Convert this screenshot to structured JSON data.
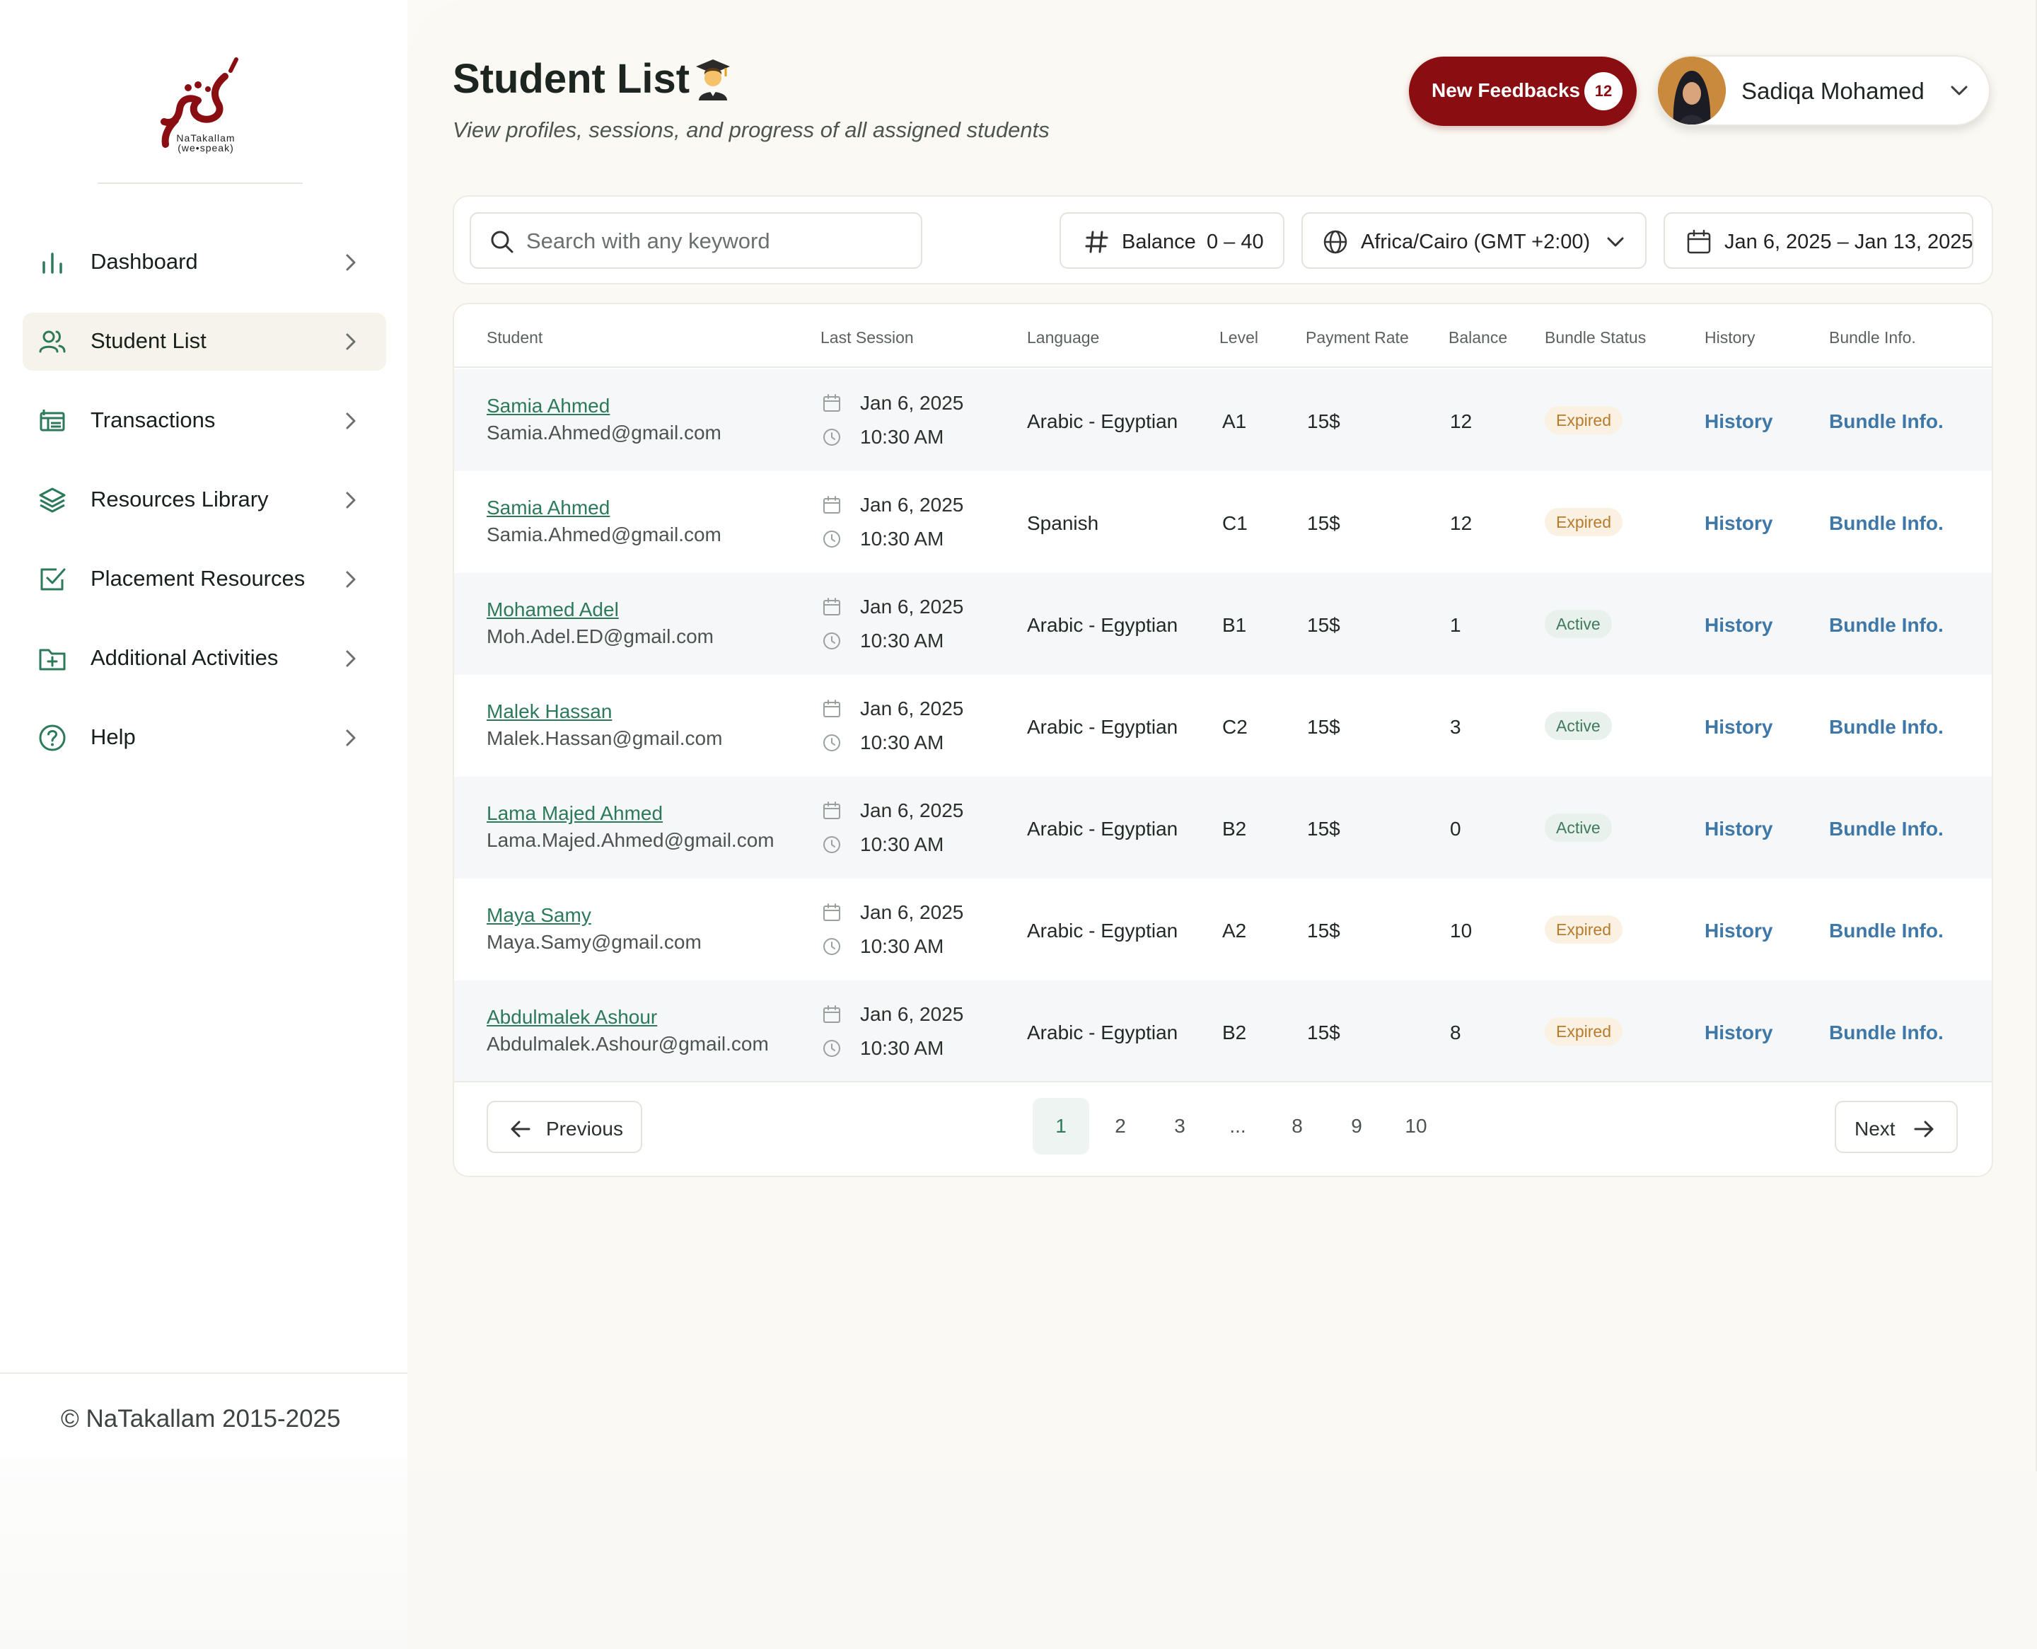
{
  "brand": {
    "logo_caption_line1": "NaTakallam",
    "logo_caption_line2": "(we•speak)",
    "copyright": "© NaTakallam 2015-2025"
  },
  "sidebar": {
    "items": [
      {
        "label": "Dashboard",
        "icon": "bar-chart-icon",
        "active": false
      },
      {
        "label": "Student List",
        "icon": "users-icon",
        "active": true
      },
      {
        "label": "Transactions",
        "icon": "transactions-icon",
        "active": false
      },
      {
        "label": "Resources Library",
        "icon": "layers-icon",
        "active": false
      },
      {
        "label": "Placement Resources",
        "icon": "check-square-icon",
        "active": false
      },
      {
        "label": "Additional Activities",
        "icon": "folder-plus-icon",
        "active": false
      },
      {
        "label": "Help",
        "icon": "help-circle-icon",
        "active": false
      }
    ]
  },
  "header": {
    "title": "Student List",
    "title_emoji": "graduate-emoji",
    "subtitle": "View profiles, sessions, and progress of all assigned students",
    "feedback_label": "New Feedbacks",
    "feedback_count": "12",
    "user_name": "Sadiqa Mohamed"
  },
  "filters": {
    "search_placeholder": "Search with any keyword",
    "balance_label": "Balance",
    "balance_range": "0 – 40",
    "timezone": "Africa/Cairo (GMT +2:00)",
    "date_range": "Jan 6, 2025 – Jan 13, 2025"
  },
  "table": {
    "columns": [
      "Student",
      "Last Session",
      "Language",
      "Level",
      "Payment Rate",
      "Balance",
      "Bundle Status",
      "History",
      "Bundle Info."
    ],
    "rows": [
      {
        "name": "Samia Ahmed",
        "email": "Samia.Ahmed@gmail.com",
        "date": "Jan 6, 2025",
        "time": "10:30 AM",
        "language": "Arabic - Egyptian",
        "level": "A1",
        "rate": "15$",
        "balance": "12",
        "status": "Expired",
        "history": "History",
        "bundle": "Bundle Info."
      },
      {
        "name": "Samia Ahmed",
        "email": "Samia.Ahmed@gmail.com",
        "date": "Jan 6, 2025",
        "time": "10:30 AM",
        "language": "Spanish",
        "level": "C1",
        "rate": "15$",
        "balance": "12",
        "status": "Expired",
        "history": "History",
        "bundle": "Bundle Info."
      },
      {
        "name": "Mohamed Adel",
        "email": "Moh.Adel.ED@gmail.com",
        "date": "Jan 6, 2025",
        "time": "10:30 AM",
        "language": "Arabic - Egyptian",
        "level": "B1",
        "rate": "15$",
        "balance": "1",
        "status": "Active",
        "history": "History",
        "bundle": "Bundle Info."
      },
      {
        "name": "Malek Hassan",
        "email": "Malek.Hassan@gmail.com",
        "date": "Jan 6, 2025",
        "time": "10:30 AM",
        "language": "Arabic - Egyptian",
        "level": "C2",
        "rate": "15$",
        "balance": "3",
        "status": "Active",
        "history": "History",
        "bundle": "Bundle Info."
      },
      {
        "name": "Lama Majed Ahmed",
        "email": "Lama.Majed.Ahmed@gmail.com",
        "date": "Jan 6, 2025",
        "time": "10:30 AM",
        "language": "Arabic - Egyptian",
        "level": "B2",
        "rate": "15$",
        "balance": "0",
        "status": "Active",
        "history": "History",
        "bundle": "Bundle Info."
      },
      {
        "name": "Maya Samy",
        "email": "Maya.Samy@gmail.com",
        "date": "Jan 6, 2025",
        "time": "10:30 AM",
        "language": "Arabic - Egyptian",
        "level": "A2",
        "rate": "15$",
        "balance": "10",
        "status": "Expired",
        "history": "History",
        "bundle": "Bundle Info."
      },
      {
        "name": "Abdulmalek Ashour",
        "email": "Abdulmalek.Ashour@gmail.com",
        "date": "Jan 6, 2025",
        "time": "10:30 AM",
        "language": "Arabic - Egyptian",
        "level": "B2",
        "rate": "15$",
        "balance": "8",
        "status": "Expired",
        "history": "History",
        "bundle": "Bundle Info."
      }
    ]
  },
  "pagination": {
    "previous_label": "Previous",
    "next_label": "Next",
    "pages": [
      "1",
      "2",
      "3",
      "...",
      "8",
      "9",
      "10"
    ],
    "current": "1"
  },
  "colors": {
    "brand_red": "#8a0d12",
    "accent_green": "#2d7a5a",
    "link_blue": "#3f78a6",
    "expired_text": "#b57b2a",
    "active_text": "#3f7a5e"
  }
}
